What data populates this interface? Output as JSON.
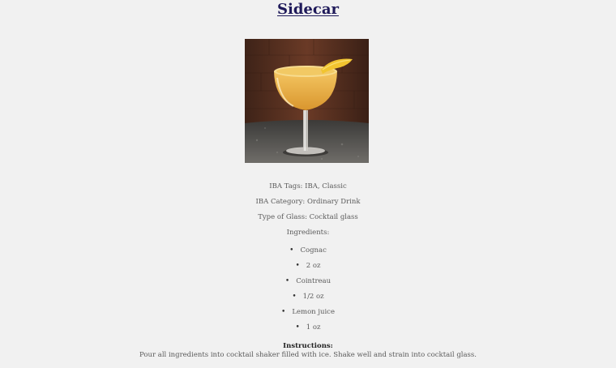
{
  "drink": {
    "name": "Sidecar",
    "image_alt": "Sidecar cocktail photo",
    "tags": "IBA Tags: IBA, Classic",
    "category": "IBA Category: Ordinary Drink",
    "glass": "Type of Glass: Cocktail glass",
    "ingredients_heading": "Ingredients:",
    "ingredients": [
      "Cognac",
      "2 oz",
      "Cointreau",
      "1/2 oz",
      "Lemon juice",
      "1 oz"
    ],
    "instructions_heading": "Instructions:",
    "instructions": "Pour all ingredients into cocktail shaker filled with ice. Shake well and strain into cocktail glass."
  },
  "colors": {
    "background": "#f1f1f1",
    "title": "#1f1a5a",
    "text": "#5a5a5a"
  }
}
